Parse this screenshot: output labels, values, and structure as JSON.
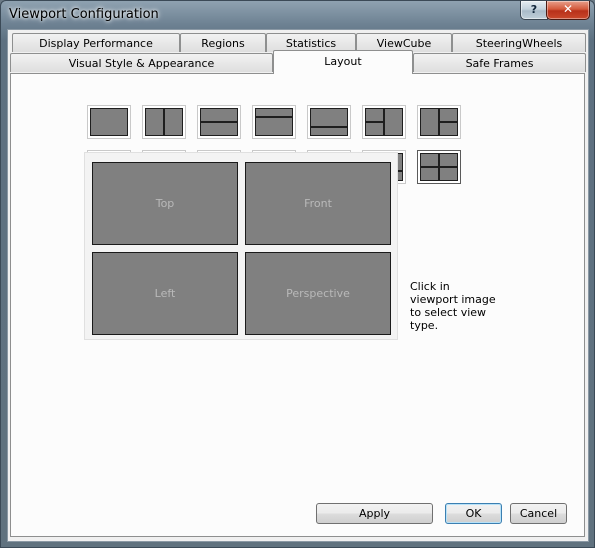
{
  "window": {
    "title": "Viewport Configuration",
    "help_label": "?",
    "close_label": "✕"
  },
  "tabs_row1": [
    "Display Performance",
    "Regions",
    "Statistics",
    "ViewCube",
    "SteeringWheels"
  ],
  "tabs_row2": [
    "Visual Style & Appearance",
    "Layout",
    "Safe Frames"
  ],
  "active_tab": "Layout",
  "layout_presets": {
    "count": 14,
    "selected_index": 13
  },
  "preview": {
    "viewports": [
      "Top",
      "Front",
      "Left",
      "Perspective"
    ],
    "hint": "Click in viewport image to select view type."
  },
  "buttons": {
    "apply": "Apply",
    "ok": "OK",
    "cancel": "Cancel"
  }
}
